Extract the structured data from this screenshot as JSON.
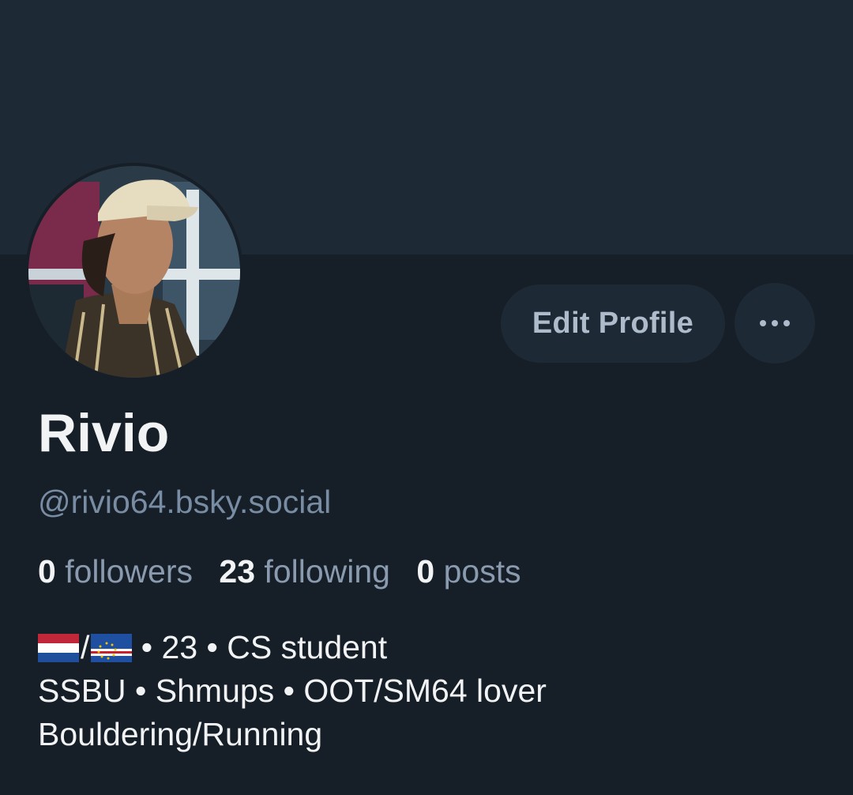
{
  "profile": {
    "display_name": "Rivio",
    "handle": "@rivio64.bsky.social",
    "stats": [
      {
        "value": "0",
        "label": "followers"
      },
      {
        "value": "23",
        "label": "following"
      },
      {
        "value": "0",
        "label": "posts"
      }
    ],
    "bio": {
      "line1_rest": " • 23 • CS student",
      "line1_slash": "/",
      "line2": "SSBU • Shmups • OOT/SM64 lover",
      "line3": "Bouldering/Running"
    },
    "flags": [
      "netherlands-flag-icon",
      "cape-verde-flag-icon"
    ]
  },
  "actions": {
    "edit_profile_label": "Edit Profile",
    "more_icon": "ellipsis-icon"
  },
  "colors": {
    "banner": "#1e2936",
    "background": "#161e27",
    "button_bg": "#1e2936",
    "text_primary": "#f1f3f5",
    "text_secondary": "#788ca3"
  }
}
